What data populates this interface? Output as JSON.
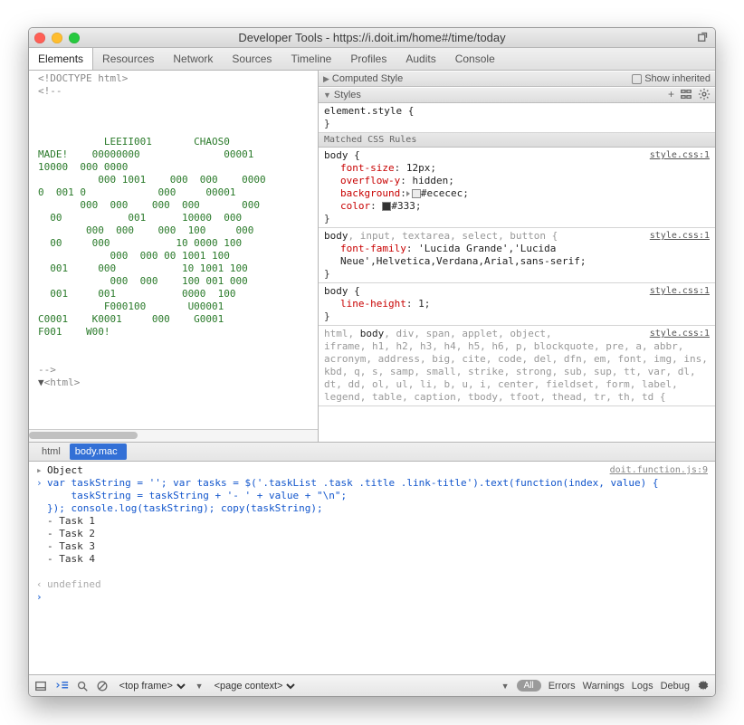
{
  "window": {
    "title": "Developer Tools - https://i.doit.im/home#/time/today"
  },
  "tabs": [
    {
      "label": "Elements"
    },
    {
      "label": "Resources"
    },
    {
      "label": "Network"
    },
    {
      "label": "Sources"
    },
    {
      "label": "Timeline"
    },
    {
      "label": "Profiles"
    },
    {
      "label": "Audits"
    },
    {
      "label": "Console"
    }
  ],
  "elements_panel": {
    "doctype": "<!DOCTYPE html>",
    "comment_open": "<!--",
    "ascii": "\n\n\n\n           LEEII001       CHAOS0\nMADE!    00000000              00001\n10000  000 0000\n          000 1001    000  000    0000\n0  001 0            000     00001\n       000  000    000  000       000\n  00           001      10000  000\n        000  000    000  100     000\n  00     000           10 0000 100\n            000  000 00 1001 100\n  001     000           10 1001 100\n            000  000    100 001 000\n  001     001           0000  100\n           F000100       U00001\nC0001    K0001     000    G0001\nF001    W00!\n\n",
    "comment_close": "-->",
    "html_tag_label": "<html>"
  },
  "styles_panel": {
    "computed_label": "Computed Style",
    "show_inherited": "Show inherited",
    "styles_label": "Styles",
    "element_style_open": "element.style {",
    "close_brace": "}",
    "matched_label": "Matched CSS Rules",
    "link": "style.css:1",
    "rule1": {
      "selector": "body {",
      "props": [
        {
          "name": "font-size",
          "value": "12px"
        },
        {
          "name": "overflow-y",
          "value": "hidden"
        },
        {
          "name": "background",
          "value": "#ececec",
          "swatch": "#ececec",
          "disclosure": true
        },
        {
          "name": "color",
          "value": "#333",
          "swatch": "#333333"
        }
      ]
    },
    "rule2": {
      "selector_main": "body",
      "selector_rest": ", input, textarea, select, button {",
      "prop": "font-family",
      "value": "'Lucida Grande','Lucida Neue',Helvetica,Verdana,Arial,sans-serif;"
    },
    "rule3": {
      "selector": "body {",
      "prop": "line-height",
      "value": "1"
    },
    "rule4": {
      "line1_pre": "html, ",
      "line1_main": "body",
      "line1_post": ", div, span, applet, object,",
      "rest": "iframe, h1, h2, h3, h4, h5, h6, p, blockquote, pre, a, abbr, acronym, address, big, cite, code, del, dfn, em, font, img, ins, kbd, q, s, samp, small, strike, strong, sub, sup, tt, var, dl, dt, dd, ol, ul, li, b, u, i, center, fieldset, form, label, legend, table, caption, tbody, tfoot, thead, tr, th, td {"
    }
  },
  "breadcrumbs": {
    "html": "html",
    "body": "body.mac"
  },
  "console": {
    "object": "Object",
    "source_link": "doit.function.js:9",
    "code": "var taskString = ''; var tasks = $('.taskList .task .title .link-title').text(function(index, value) {\n    taskString = taskString + '- ' + value + \"\\n\";\n}); console.log(taskString); copy(taskString);",
    "output": "- Task 1\n- Task 2\n- Task 3\n- Task 4\n ",
    "undefined": "undefined"
  },
  "footer": {
    "frame": "<top frame>",
    "context": "<page context>",
    "all": "All",
    "filters": [
      "Errors",
      "Warnings",
      "Logs",
      "Debug"
    ]
  },
  "colors": {
    "red": "#ff5f56",
    "yellow": "#ffbd2e",
    "green": "#27c93f"
  }
}
